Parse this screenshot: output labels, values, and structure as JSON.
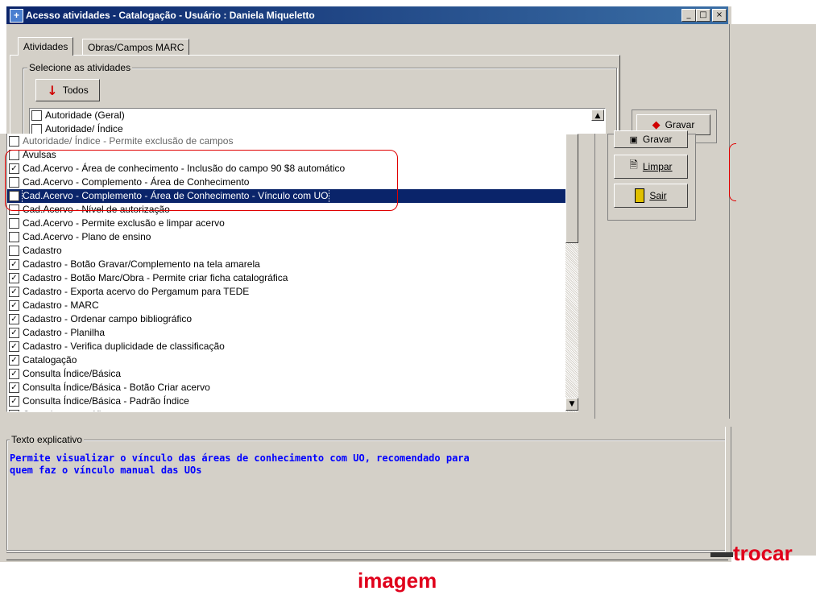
{
  "window": {
    "title": "Acesso atividades - Catalogação - Usuário : Daniela Miqueletto",
    "controls": {
      "minimize": "_",
      "maximize": "□",
      "close": "×"
    }
  },
  "tabs": [
    {
      "label": "Atividades",
      "active": true
    },
    {
      "label": "Obras/Campos MARC",
      "active": false
    }
  ],
  "group_label": "Selecione as atividades",
  "todos_button": "Todos",
  "top_list": [
    {
      "label": "Autoridade (Geral)",
      "checked": false
    },
    {
      "label": "Autoridade/ Índice",
      "checked": false
    }
  ],
  "overlap_text": "Autoridade/ Índice - Permite exclusão de campos",
  "main_list": [
    {
      "label": "Avulsas",
      "checked": false
    },
    {
      "label": "Cad.Acervo - Área de conhecimento - Inclusão do campo 90 $8 automático",
      "checked": true
    },
    {
      "label": "Cad.Acervo - Complemento - Área de Conhecimento",
      "checked": false
    },
    {
      "label": "Cad.Acervo - Complemento - Área de Conhecimento - Vínculo com UO",
      "checked": true,
      "selected": true
    },
    {
      "label": "Cad.Acervo - Nível de autorização",
      "checked": false
    },
    {
      "label": "Cad.Acervo - Permite exclusão e limpar acervo",
      "checked": false
    },
    {
      "label": "Cad.Acervo - Plano de ensino",
      "checked": false
    },
    {
      "label": "Cadastro",
      "checked": false
    },
    {
      "label": "Cadastro - Botão Gravar/Complemento na tela amarela",
      "checked": true
    },
    {
      "label": "Cadastro - Botão Marc/Obra - Permite criar ficha catalográfica",
      "checked": true
    },
    {
      "label": "Cadastro - Exporta acervo do Pergamum para TEDE",
      "checked": true
    },
    {
      "label": "Cadastro - MARC",
      "checked": true
    },
    {
      "label": "Cadastro - Ordenar campo bibliográfico",
      "checked": true
    },
    {
      "label": "Cadastro - Planilha",
      "checked": true
    },
    {
      "label": "Cadastro - Verifica duplicidade de classificação",
      "checked": true
    },
    {
      "label": "Catalogação",
      "checked": true
    },
    {
      "label": "Consulta Índice/Básica",
      "checked": true
    },
    {
      "label": "Consulta Índice/Básica - Botão Criar acervo",
      "checked": true
    },
    {
      "label": "Consulta Índice/Básica - Padrão Índice",
      "checked": true
    },
    {
      "label": "Consulta topográfico",
      "checked": true
    }
  ],
  "buttons": {
    "gravar": "Gravar",
    "limpar": "Limpar",
    "sair": "Sair"
  },
  "explanation": {
    "label": "Texto explicativo",
    "text": "Permite visualizar o vínculo das áreas de conhecimento com UO, recomendado para\nquem faz o vínculo manual das UOs"
  },
  "caption": {
    "line1": "trocar",
    "line2": "imagem",
    "color": "#e0001b"
  },
  "colors": {
    "selection": "#0a246a",
    "highlight_box": "#e00000",
    "memo_text": "#0000ff"
  }
}
